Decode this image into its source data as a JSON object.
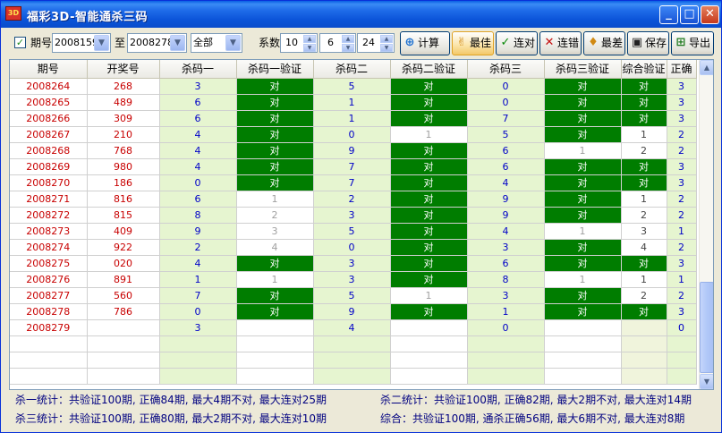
{
  "window": {
    "title": "福彩3D-智能通杀三码",
    "icon_text": "3D",
    "min_label": "_",
    "max_label": "□",
    "close_label": "✕"
  },
  "toolbar": {
    "period_check_label": "期号",
    "period_from": "2008159",
    "to_label": "至",
    "period_to": "2008278",
    "scope": "全部",
    "coef_label": "系数",
    "coef1": "10",
    "coef2": "6",
    "coef3": "24",
    "buttons": {
      "calc": "计算",
      "best": "最佳",
      "streak_right": "连对",
      "streak_wrong": "连错",
      "worst": "最差",
      "save": "保存",
      "export": "导出"
    }
  },
  "table": {
    "headers": [
      "期号",
      "开奖号",
      "杀码一",
      "杀码一验证",
      "杀码二",
      "杀码二验证",
      "杀码三",
      "杀码三验证",
      "综合验证",
      "正确"
    ],
    "rows": [
      [
        "2008264",
        "268",
        "3",
        "对",
        "5",
        "对",
        "0",
        "对",
        "对",
        "3"
      ],
      [
        "2008265",
        "489",
        "6",
        "对",
        "1",
        "对",
        "0",
        "对",
        "对",
        "3"
      ],
      [
        "2008266",
        "309",
        "6",
        "对",
        "1",
        "对",
        "7",
        "对",
        "对",
        "3"
      ],
      [
        "2008267",
        "210",
        "4",
        "对",
        "0",
        "1",
        "5",
        "对",
        "1",
        "2"
      ],
      [
        "2008268",
        "768",
        "4",
        "对",
        "9",
        "对",
        "6",
        "1",
        "2",
        "2"
      ],
      [
        "2008269",
        "980",
        "4",
        "对",
        "7",
        "对",
        "6",
        "对",
        "对",
        "3"
      ],
      [
        "2008270",
        "186",
        "0",
        "对",
        "7",
        "对",
        "4",
        "对",
        "对",
        "3"
      ],
      [
        "2008271",
        "816",
        "6",
        "1",
        "2",
        "对",
        "9",
        "对",
        "1",
        "2"
      ],
      [
        "2008272",
        "815",
        "8",
        "2",
        "3",
        "对",
        "9",
        "对",
        "2",
        "2"
      ],
      [
        "2008273",
        "409",
        "9",
        "3",
        "5",
        "对",
        "4",
        "1",
        "3",
        "1"
      ],
      [
        "2008274",
        "922",
        "2",
        "4",
        "0",
        "对",
        "3",
        "对",
        "4",
        "2"
      ],
      [
        "2008275",
        "020",
        "4",
        "对",
        "3",
        "对",
        "6",
        "对",
        "对",
        "3"
      ],
      [
        "2008276",
        "891",
        "1",
        "1",
        "3",
        "对",
        "8",
        "1",
        "1",
        "1"
      ],
      [
        "2008277",
        "560",
        "7",
        "对",
        "5",
        "1",
        "3",
        "对",
        "2",
        "2"
      ],
      [
        "2008278",
        "786",
        "0",
        "对",
        "9",
        "对",
        "1",
        "对",
        "对",
        "3"
      ],
      [
        "2008279",
        "",
        "3",
        "",
        "4",
        "",
        "0",
        "",
        "",
        "0"
      ]
    ]
  },
  "stats": {
    "kill1": "杀一统计：共验证100期, 正确84期, 最大4期不对, 最大连对25期",
    "kill2": "杀二统计：共验证100期, 正确82期, 最大2期不对, 最大连对14期",
    "kill3": "杀三统计：共验证100期, 正确80期, 最大2期不对, 最大连对10期",
    "combined": "综合：共验证100期, 通杀正确56期, 最大6期不对, 最大连对8期"
  }
}
